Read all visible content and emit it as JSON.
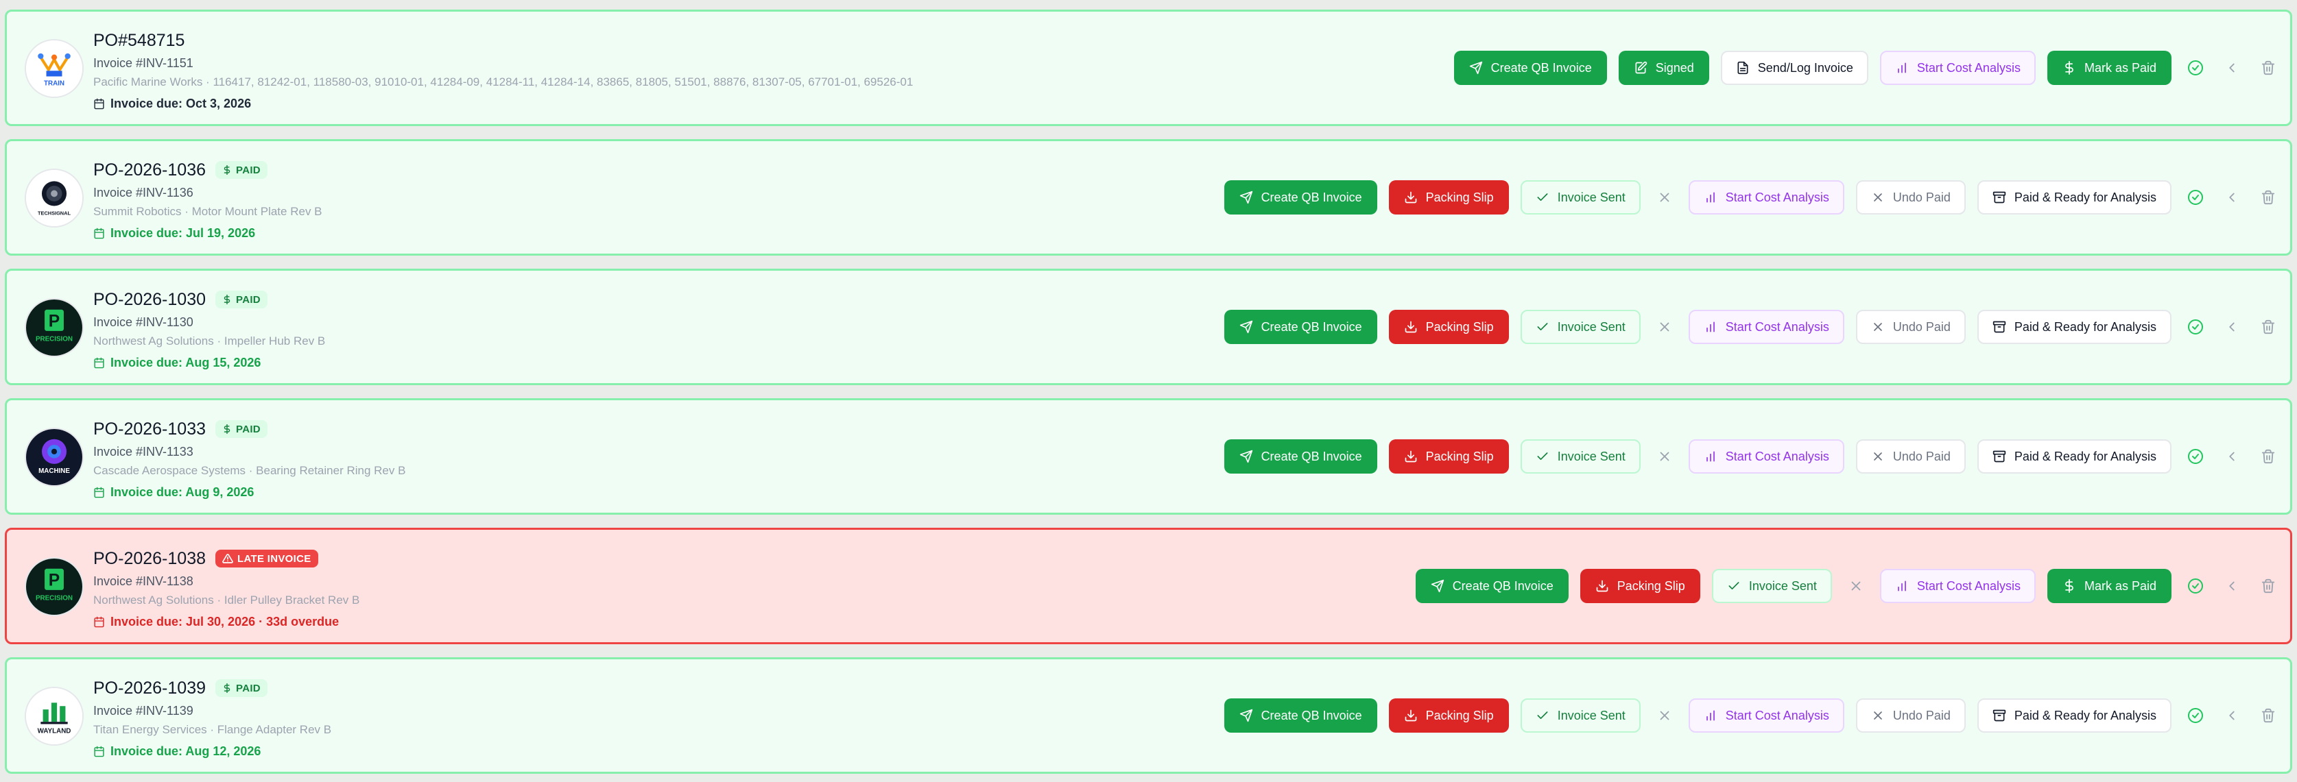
{
  "colors": {
    "primary_green": "#16a34a",
    "danger_red": "#dc2626",
    "paid_badge_bg": "#dcfce7",
    "card_bg": "#f0fdf4",
    "late_card_bg": "#fee2e2",
    "purple_text": "#9333ea"
  },
  "orders": [
    {
      "po": "PO#548715",
      "badge": null,
      "invoice": "Invoice #INV-1151",
      "description": "Pacific Marine Works · 116417, 81242-01, 118580-03, 91010-01, 41284-09, 41284-11, 41284-14, 83865, 81805, 51501, 88876, 81307-05, 67701-01, 69526-01",
      "due": "Invoice due: Oct 3, 2026",
      "logo": "train",
      "logo_text": "TRAIN",
      "actions": [
        {
          "type": "green",
          "icon": "send-icon",
          "label": "Create QB Invoice"
        },
        {
          "type": "green",
          "icon": "signature-icon",
          "label": "Signed"
        },
        {
          "type": "white",
          "icon": "file-icon",
          "label": "Send/Log Invoice"
        },
        {
          "type": "purple",
          "icon": "chart-icon",
          "label": "Start Cost Analysis"
        },
        {
          "type": "green",
          "icon": "dollar-icon",
          "label": "Mark as Paid"
        }
      ]
    },
    {
      "po": "PO-2026-1036",
      "badge": "PAID",
      "invoice": "Invoice #INV-1136",
      "description": "Summit Robotics · Motor Mount Plate Rev B",
      "due": "Invoice due: Jul 19, 2026",
      "logo": "gear",
      "logo_text": "TECHSIGNAL",
      "actions": [
        {
          "type": "green",
          "icon": "send-icon",
          "label": "Create QB Invoice"
        },
        {
          "type": "red",
          "icon": "download-icon",
          "label": "Packing Slip"
        },
        {
          "type": "sent",
          "icon": "check-icon",
          "label": "Invoice Sent"
        },
        {
          "type": "x"
        },
        {
          "type": "purple",
          "icon": "chart-icon",
          "label": "Start Cost Analysis"
        },
        {
          "type": "undo",
          "icon": "x-icon",
          "label": "Undo Paid"
        },
        {
          "type": "white",
          "icon": "archive-icon",
          "label": "Paid & Ready for Analysis"
        }
      ]
    },
    {
      "po": "PO-2026-1030",
      "badge": "PAID",
      "invoice": "Invoice #INV-1130",
      "description": "Northwest Ag Solutions · Impeller Hub Rev B",
      "due": "Invoice due: Aug 15, 2026",
      "logo": "precision",
      "logo_text": "PRECISION",
      "actions": [
        {
          "type": "green",
          "icon": "send-icon",
          "label": "Create QB Invoice"
        },
        {
          "type": "red",
          "icon": "download-icon",
          "label": "Packing Slip"
        },
        {
          "type": "sent",
          "icon": "check-icon",
          "label": "Invoice Sent"
        },
        {
          "type": "x"
        },
        {
          "type": "purple",
          "icon": "chart-icon",
          "label": "Start Cost Analysis"
        },
        {
          "type": "undo",
          "icon": "x-icon",
          "label": "Undo Paid"
        },
        {
          "type": "white",
          "icon": "archive-icon",
          "label": "Paid & Ready for Analysis"
        }
      ]
    },
    {
      "po": "PO-2026-1033",
      "badge": "PAID",
      "invoice": "Invoice #INV-1133",
      "description": "Cascade Aerospace Systems · Bearing Retainer Ring Rev B",
      "due": "Invoice due: Aug 9, 2026",
      "logo": "machine",
      "logo_text": "MACHINE",
      "actions": [
        {
          "type": "green",
          "icon": "send-icon",
          "label": "Create QB Invoice"
        },
        {
          "type": "red",
          "icon": "download-icon",
          "label": "Packing Slip"
        },
        {
          "type": "sent",
          "icon": "check-icon",
          "label": "Invoice Sent"
        },
        {
          "type": "x"
        },
        {
          "type": "purple",
          "icon": "chart-icon",
          "label": "Start Cost Analysis"
        },
        {
          "type": "undo",
          "icon": "x-icon",
          "label": "Undo Paid"
        },
        {
          "type": "white",
          "icon": "archive-icon",
          "label": "Paid & Ready for Analysis"
        }
      ]
    },
    {
      "po": "PO-2026-1038",
      "badge": "LATE INVOICE",
      "invoice": "Invoice #INV-1138",
      "description": "Northwest Ag Solutions · Idler Pulley Bracket Rev B",
      "due": "Invoice due: Jul 30, 2026 · 33d overdue",
      "logo": "precision",
      "logo_text": "PRECISION",
      "actions": [
        {
          "type": "green",
          "icon": "send-icon",
          "label": "Create QB Invoice"
        },
        {
          "type": "red",
          "icon": "download-icon",
          "label": "Packing Slip"
        },
        {
          "type": "sent",
          "icon": "check-icon",
          "label": "Invoice Sent"
        },
        {
          "type": "x"
        },
        {
          "type": "purple",
          "icon": "chart-icon",
          "label": "Start Cost Analysis"
        },
        {
          "type": "green",
          "icon": "dollar-icon",
          "label": "Mark as Paid"
        }
      ]
    },
    {
      "po": "PO-2026-1039",
      "badge": "PAID",
      "invoice": "Invoice #INV-1139",
      "description": "Titan Energy Services · Flange Adapter Rev B",
      "due": "Invoice due: Aug 12, 2026",
      "logo": "wayland",
      "logo_text": "WAYLAND",
      "actions": [
        {
          "type": "green",
          "icon": "send-icon",
          "label": "Create QB Invoice"
        },
        {
          "type": "red",
          "icon": "download-icon",
          "label": "Packing Slip"
        },
        {
          "type": "sent",
          "icon": "check-icon",
          "label": "Invoice Sent"
        },
        {
          "type": "x"
        },
        {
          "type": "purple",
          "icon": "chart-icon",
          "label": "Start Cost Analysis"
        },
        {
          "type": "undo",
          "icon": "x-icon",
          "label": "Undo Paid"
        },
        {
          "type": "white",
          "icon": "archive-icon",
          "label": "Paid & Ready for Analysis"
        }
      ]
    }
  ]
}
